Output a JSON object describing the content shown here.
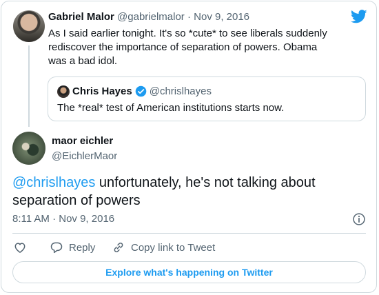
{
  "tweet_parent": {
    "name": "Gabriel Malor",
    "handle": "@gabrielmalor",
    "sep": "·",
    "date": "Nov 9, 2016",
    "text": "As I said earlier tonight. It's so *cute* to see liberals suddenly rediscover the importance of separation of powers. Obama was a bad idol."
  },
  "quoted": {
    "name": "Chris Hayes",
    "handle": "@chrislhayes",
    "text": "The *real* test of American institutions starts now."
  },
  "tweet_main": {
    "name": "maor eichler",
    "handle": "@EichlerMaor",
    "mention": "@chrislhayes",
    "text": " unfortunately, he's not talking about separation of powers",
    "timestamp": "8:11 AM · Nov 9, 2016"
  },
  "actions": {
    "reply": "Reply",
    "copy_link": "Copy link to Tweet"
  },
  "explore_label": "Explore what's happening on Twitter",
  "icons": {
    "brand": "twitter-bird-icon",
    "verified": "verified-badge-icon",
    "info": "info-icon",
    "like": "heart-icon",
    "reply": "reply-bubble-icon",
    "link": "link-icon"
  },
  "colors": {
    "accent": "#1d9bf0",
    "muted": "#536471",
    "border": "#cfd9de"
  }
}
